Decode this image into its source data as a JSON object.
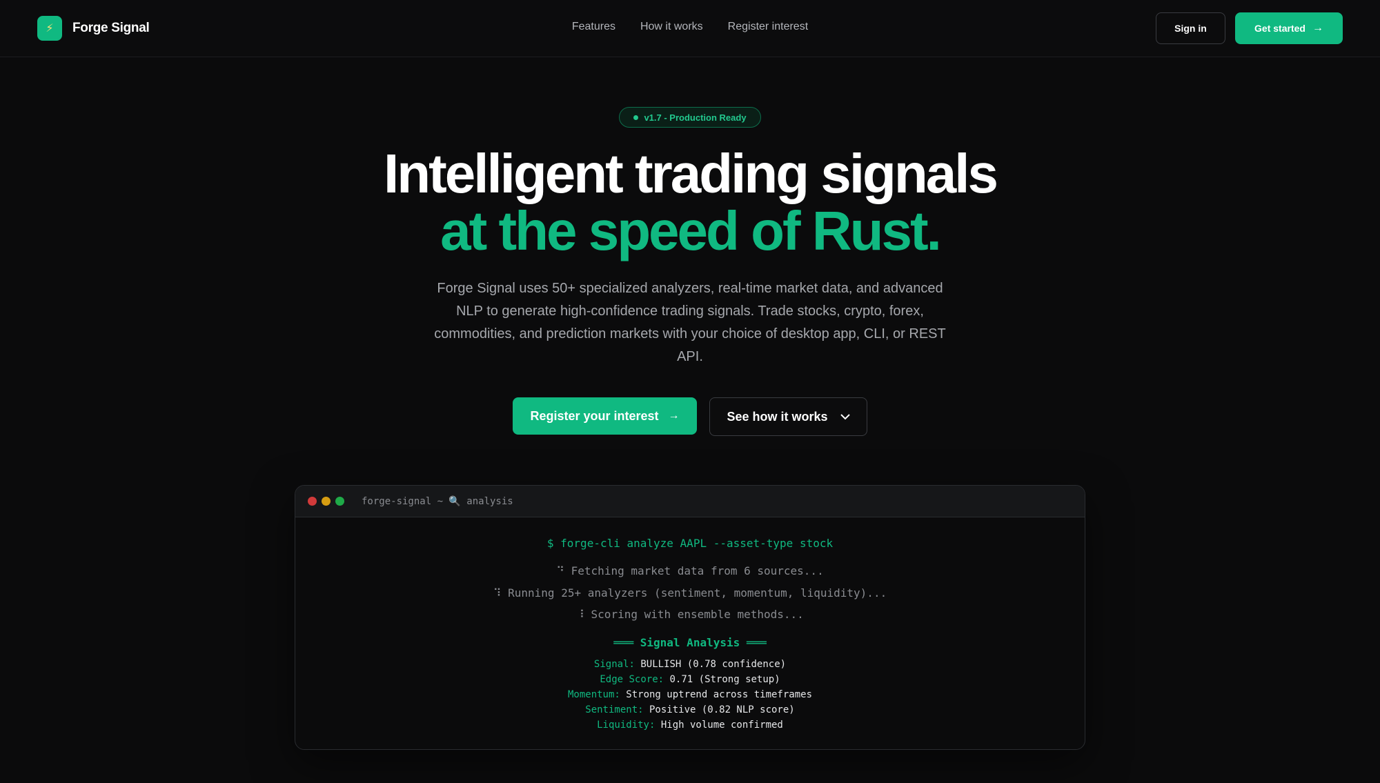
{
  "colors": {
    "accent": "#10b981",
    "background": "#0b0b0c",
    "muted_text": "#a6a8ad"
  },
  "nav": {
    "brand_icon": "lightning-icon",
    "brand_name": "Forge Signal",
    "links": [
      "Features",
      "How it works",
      "Register interest"
    ],
    "sign_in_label": "Sign in",
    "get_started_label": "Get started"
  },
  "hero": {
    "badge": "v1.7 - Production Ready",
    "title_line1": "Intelligent trading signals",
    "title_line2": "at the speed of Rust.",
    "subtitle": "Forge Signal uses 50+ specialized analyzers, real-time market data, and advanced NLP to generate high-confidence trading signals. Trade stocks, crypto, forex, commodities, and prediction markets with your choice of desktop app, CLI, or REST API.",
    "cta_primary": "Register your interest",
    "cta_secondary": "See how it works"
  },
  "terminal": {
    "title": "forge-signal ~ 🔍 analysis",
    "command": "$ forge-cli analyze AAPL --asset-type stock",
    "steps": [
      "⠙ Fetching market data from 6 sources...",
      "⠹ Running 25+ analyzers (sentiment, momentum, liquidity)...",
      "⠸ Scoring with ensemble methods..."
    ],
    "heading": "═══ Signal Analysis ═══",
    "results": [
      {
        "key": "Signal:",
        "value": "BULLISH (0.78 confidence)"
      },
      {
        "key": "Edge Score:",
        "value": "0.71 (Strong setup)"
      },
      {
        "key": "Momentum:",
        "value": "Strong uptrend across timeframes"
      },
      {
        "key": "Sentiment:",
        "value": "Positive (0.82 NLP score)"
      },
      {
        "key": "Liquidity:",
        "value": "High volume confirmed"
      }
    ]
  }
}
